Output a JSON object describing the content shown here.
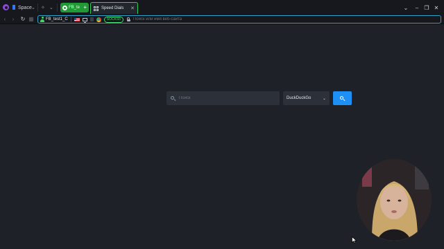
{
  "titlebar": {
    "space_label": "Space",
    "profile_tab_label": "FB_te",
    "active_tab_label": "Speed Dials",
    "colors": {
      "profile_tab": "#1f9a35",
      "active_tab_border": "#2fd05a"
    },
    "icons": [
      "app-icon",
      "flag-icon",
      "chevron-down-icon",
      "extensions-icon",
      "plus-icon",
      "speed-dial-grid-icon",
      "close-icon",
      "minimize-icon",
      "maximize-icon",
      "window-close-icon"
    ]
  },
  "addressbar": {
    "profile_name": "FB_test1_C",
    "proxy_badge": "SOCKS5",
    "placeholder": "Поиск или имя веб-сайта",
    "colors": {
      "border": "#2fa3c9",
      "badge": "#3fd86a"
    }
  },
  "speed_dial": {
    "search_placeholder": "Поиск",
    "engine": "DuckDuckGo",
    "colors": {
      "search_button": "#1e90f5"
    }
  }
}
